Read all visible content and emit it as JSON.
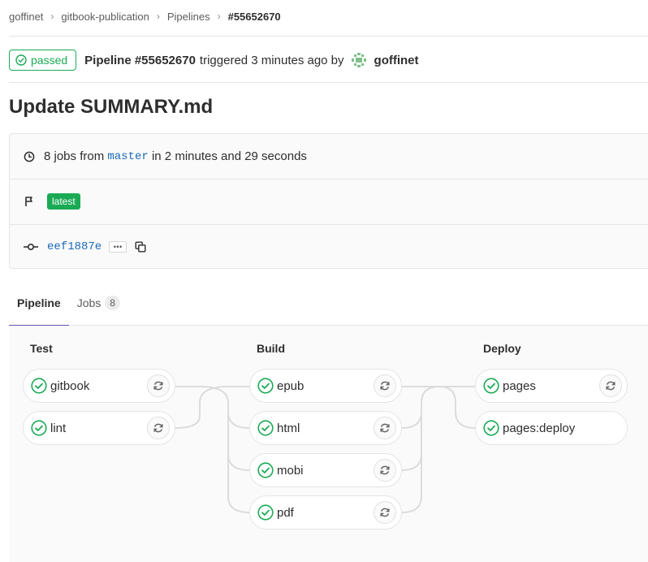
{
  "breadcrumb": {
    "items": [
      "goffinet",
      "gitbook-publication",
      "Pipelines"
    ],
    "current": "#55652670"
  },
  "header": {
    "status": "passed",
    "pipeline_id": "Pipeline #55652670",
    "triggered_text": "triggered 3 minutes ago by",
    "user": "goffinet"
  },
  "title": "Update SUMMARY.md",
  "info": {
    "jobs_prefix": "8 jobs from",
    "branch": "master",
    "duration": "in 2 minutes and 29 seconds",
    "tag": "latest",
    "sha": "eef1887e",
    "ellipsis": "•••"
  },
  "tabs": {
    "pipeline": "Pipeline",
    "jobs": "Jobs",
    "jobs_count": "8"
  },
  "stages": [
    {
      "name": "Test",
      "jobs": [
        "gitbook",
        "lint"
      ]
    },
    {
      "name": "Build",
      "jobs": [
        "epub",
        "html",
        "mobi",
        "pdf"
      ]
    },
    {
      "name": "Deploy",
      "jobs": [
        "pages",
        "pages:deploy"
      ]
    }
  ],
  "colors": {
    "success": "#1aaa55",
    "link": "#1b69b6",
    "tab_accent": "#6b4fbb"
  }
}
